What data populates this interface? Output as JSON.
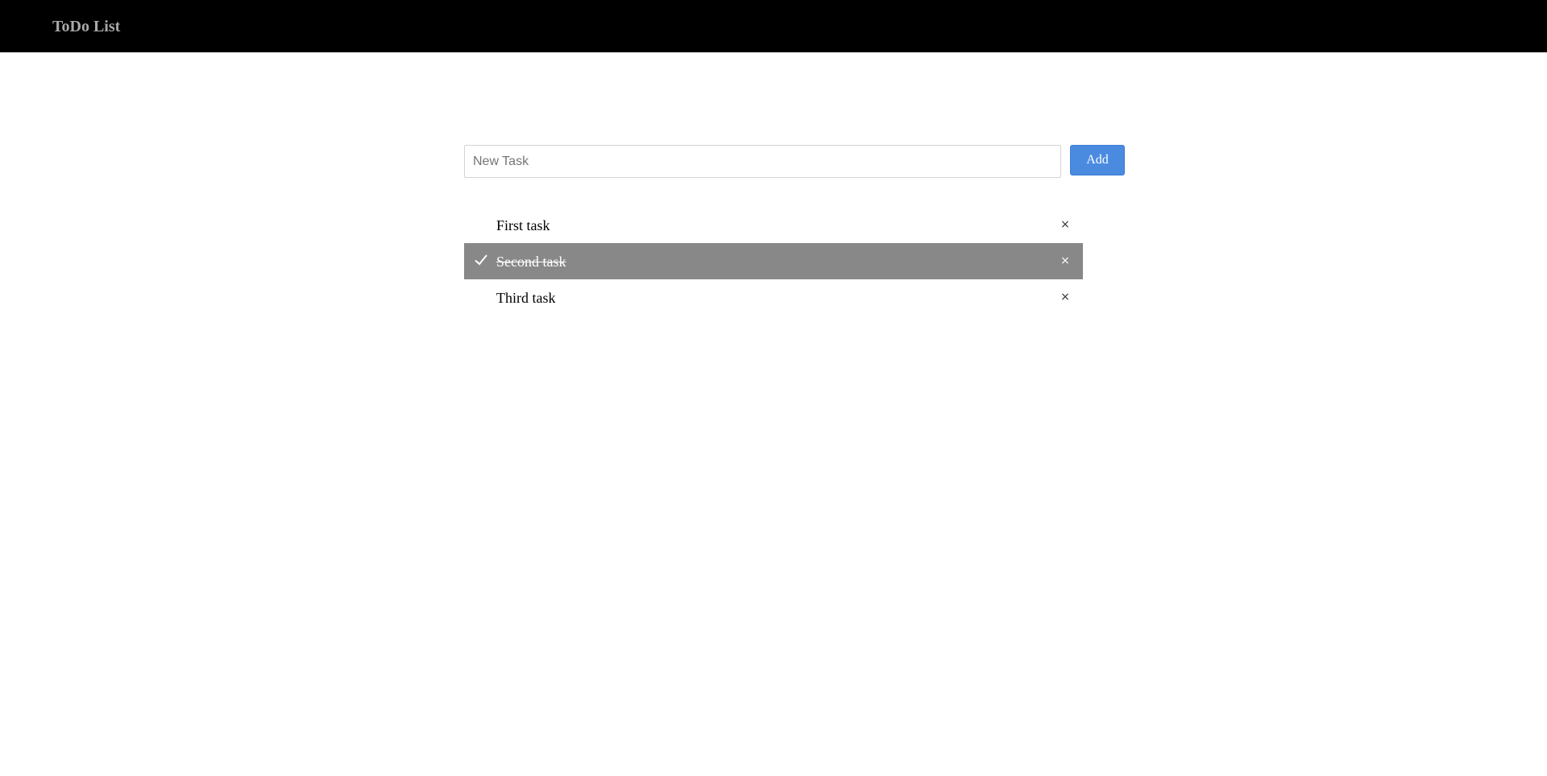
{
  "header": {
    "title": "ToDo List"
  },
  "form": {
    "input_placeholder": "New Task",
    "input_value": "",
    "add_label": "Add"
  },
  "tasks": [
    {
      "text": "First task",
      "checked": false,
      "close_label": "×"
    },
    {
      "text": "Second task",
      "checked": true,
      "close_label": "×"
    },
    {
      "text": "Third task",
      "checked": false,
      "close_label": "×"
    }
  ],
  "icons": {
    "check": "check-icon",
    "close": "close-icon"
  },
  "colors": {
    "header_bg": "#000000",
    "header_text": "#a9a9a9",
    "button_bg": "#4a8be0",
    "checked_row_bg": "#888888"
  }
}
